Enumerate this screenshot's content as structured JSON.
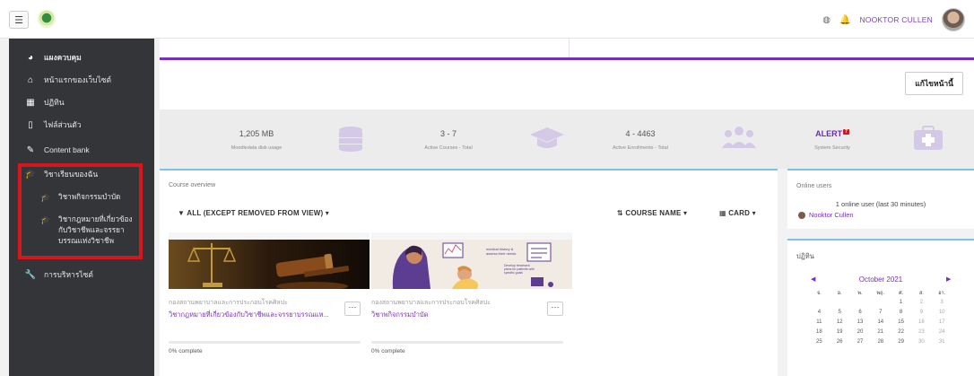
{
  "navbar": {
    "user_name": "NOOKTOR CULLEN"
  },
  "sidebar": {
    "items": [
      {
        "label": "แผงควบคุม",
        "icon": "dashboard-icon"
      },
      {
        "label": "หน้าแรกของเว็บไซต์",
        "icon": "home-icon"
      },
      {
        "label": "ปฏิทิน",
        "icon": "calendar-icon"
      },
      {
        "label": "ไฟล์ส่วนตัว",
        "icon": "file-icon"
      },
      {
        "label": "Content bank",
        "icon": "pencil-icon"
      },
      {
        "label": "วิชาเรียนของฉัน",
        "icon": "graduation-cap-icon"
      }
    ],
    "courses": [
      {
        "label": "วิชาพกิจกรรมบำบัด"
      },
      {
        "label_lines": [
          "วิชากฎหมายที่เกี่ยวข้อง",
          "กับวิชาชีพและจรรยา",
          "บรรณแห่งวิชาชีพ"
        ]
      }
    ],
    "admin": {
      "label": "การบริหารไซต์",
      "icon": "wrench-icon"
    }
  },
  "header": {
    "edit_button": "แก้ไขหน้านี้"
  },
  "stats": [
    {
      "value": "1,205 MB",
      "label": "Moodledata disk usage",
      "icon": "database-icon"
    },
    {
      "value": "3 - 7",
      "label": "Active Courses - Total",
      "icon": "graduation-cap-icon"
    },
    {
      "value": "4 - 4463",
      "label": "Active Enrollments - Total",
      "icon": "users-icon"
    },
    {
      "value": "ALERT",
      "badge": "7",
      "label": "System Security",
      "icon": "medkit-icon"
    }
  ],
  "course_overview": {
    "title": "Course overview",
    "filter": "ALL (EXCEPT REMOVED FROM VIEW)",
    "sort": "COURSE NAME",
    "view": "CARD",
    "cards": [
      {
        "category": "กองสถานพยาบาลและการประกอบโรคศิลปะ",
        "name": "วิชากฎหมายที่เกี่ยวข้องกับวิชาชีพและจรรยาบรรณแห...",
        "progress": 0,
        "progress_label": "0% complete",
        "image": "law-gavel"
      },
      {
        "category": "กองสถานพยาบาลและการประกอบโรคศิลปะ",
        "name": "วิชาพกิจกรรมบำบัด",
        "progress": 0,
        "progress_label": "0% complete",
        "image": "therapy-illustration"
      }
    ]
  },
  "online_users": {
    "title": "Online users",
    "count_text": "1 online user (last 30 minutes)",
    "user": "Nooktor Cullen"
  },
  "calendar": {
    "title": "ปฏิทิน",
    "month": "October 2021",
    "weekdays": [
      "จ.",
      "อ.",
      "พ.",
      "พฤ.",
      "ศ.",
      "ส.",
      "อา."
    ],
    "weeks": [
      [
        "",
        "",
        "",
        "",
        "1",
        "2",
        "3"
      ],
      [
        "4",
        "5",
        "6",
        "7",
        "8",
        "9",
        "10"
      ],
      [
        "11",
        "12",
        "13",
        "14",
        "15",
        "16",
        "17"
      ],
      [
        "18",
        "19",
        "20",
        "21",
        "22",
        "23",
        "24"
      ],
      [
        "25",
        "26",
        "27",
        "28",
        "29",
        "30",
        "31"
      ]
    ]
  }
}
